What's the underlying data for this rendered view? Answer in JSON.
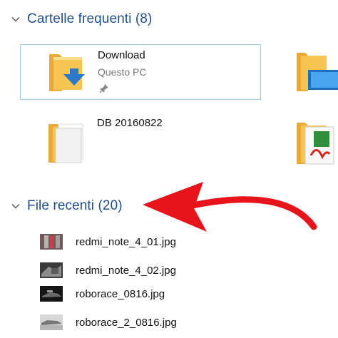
{
  "frequent": {
    "title": "Cartelle frequenti (8)",
    "folders": [
      {
        "name": "Download",
        "location": "Questo PC",
        "pinned": true,
        "icon": "download-folder-icon"
      },
      {
        "name": "DB 20160822",
        "location": "",
        "pinned": false,
        "icon": "document-folder-icon"
      }
    ],
    "partial_folders": [
      {
        "icon": "desktop-folder-icon"
      },
      {
        "icon": "pdf-folder-icon"
      }
    ]
  },
  "recent": {
    "title": "File recenti (20)",
    "files": [
      {
        "name": "redmi_note_4_01.jpg",
        "icon": "image-thumbnail"
      },
      {
        "name": "redmi_note_4_02.jpg",
        "icon": "image-thumbnail"
      },
      {
        "name": "roborace_0816.jpg",
        "icon": "image-thumbnail"
      },
      {
        "name": "roborace_2_0816.jpg",
        "icon": "image-thumbnail"
      }
    ]
  },
  "annotation": {
    "type": "arrow",
    "color": "#e8141c"
  },
  "colors": {
    "accent": "#1f4e8c",
    "folder": "#f5c451",
    "selection_border": "#99c9ef"
  }
}
